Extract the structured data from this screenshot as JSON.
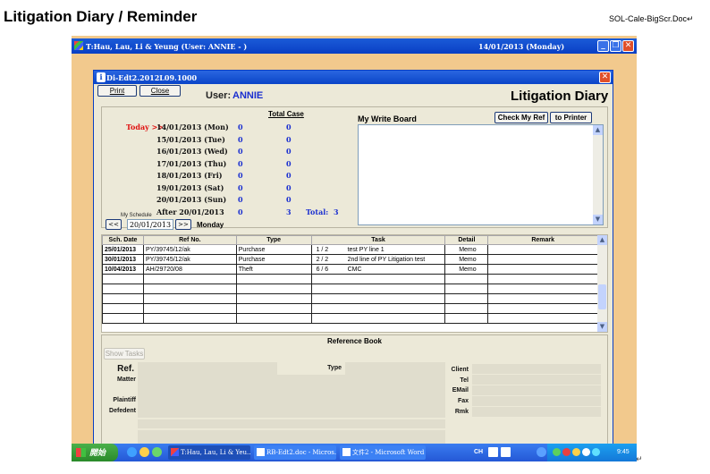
{
  "doc": {
    "heading": "Litigation Diary / Reminder",
    "filename": "SOL-Cale-BigScr.Doc",
    "return_mark": "↵"
  },
  "main_window": {
    "title": "T:Hau, Lau, Li & Yeung  (User: ANNIE - )",
    "date": "14/01/2013   (Monday)"
  },
  "dialog": {
    "title": "Di-Edt2.2012L09.1000",
    "print_label": "Print",
    "close_label": "Close",
    "user_label": "User:",
    "user_name": "ANNIE",
    "diary_title": "Litigation Diary"
  },
  "schedule": {
    "today_marker": "Today >>",
    "total_case_label": "Total Case",
    "rows": [
      {
        "date": "14/01/2013 (Mon)",
        "a": "0",
        "b": "0"
      },
      {
        "date": "15/01/2013 (Tue)",
        "a": "0",
        "b": "0"
      },
      {
        "date": "16/01/2013 (Wed)",
        "a": "0",
        "b": "0"
      },
      {
        "date": "17/01/2013 (Thu)",
        "a": "0",
        "b": "0"
      },
      {
        "date": "18/01/2013 (Fri)",
        "a": "0",
        "b": "0"
      },
      {
        "date": "19/01/2013 (Sat)",
        "a": "0",
        "b": "0"
      },
      {
        "date": "20/01/2013 (Sun)",
        "a": "0",
        "b": "0"
      },
      {
        "date": "After 20/01/2013",
        "a": "0",
        "b": "3"
      }
    ],
    "total_label": "Total:",
    "total_value": "3",
    "my_schedule_label": "My Schedule",
    "prev_label": "<<",
    "next_label": ">>",
    "date_value": "20/01/2013",
    "day_label": "Monday"
  },
  "writeboard": {
    "label": "My Write Board",
    "check_ref_label": "Check My Ref",
    "to_printer_label": "to Printer",
    "content": ""
  },
  "grid": {
    "columns": [
      "Sch. Date",
      "Ref No.",
      "Type",
      "Task",
      "Detail",
      "Remark"
    ],
    "rows": [
      {
        "date": "25/01/2013",
        "ref": "PY/39745/12/ak",
        "type": "Purchase",
        "task_num": "1  /  2",
        "task": "test PY line 1",
        "detail": "Memo",
        "remark": ""
      },
      {
        "date": "30/01/2013",
        "ref": "PY/39745/12/ak",
        "type": "Purchase",
        "task_num": "2  /  2",
        "task": "2nd line of PY Litigation test",
        "detail": "Memo",
        "remark": ""
      },
      {
        "date": "10/04/2013",
        "ref": "AH/29720/08",
        "type": "Theft",
        "task_num": "6  /  6",
        "task": "CMC",
        "detail": "Memo",
        "remark": ""
      }
    ]
  },
  "reference": {
    "title": "Reference Book",
    "show_tasks_label": "Show Tasks",
    "ref_label": "Ref.",
    "type_label": "Type",
    "matter_label": "Matter",
    "plaintiff_label": "Plaintiff",
    "defendant_label": "Defedent",
    "client_label": "Client",
    "tel_label": "Tel",
    "email_label": "EMail",
    "fax_label": "Fax",
    "rmk_label": "Rmk"
  },
  "taskbar": {
    "start_label": "開始",
    "tasks": [
      "T:Hau, Lau, Li & Yeu...",
      "RB-Edt2.doc - Micros...",
      "文件2 - Microsoft Word"
    ],
    "ime": "CH",
    "clock": "9:45"
  },
  "colors": {
    "desktop": "#f2c98d",
    "titlebar": "#0a3fc4",
    "dialog_bg": "#ece9d8",
    "today_red": "#e01010",
    "count_blue": "#1a2fd0"
  }
}
